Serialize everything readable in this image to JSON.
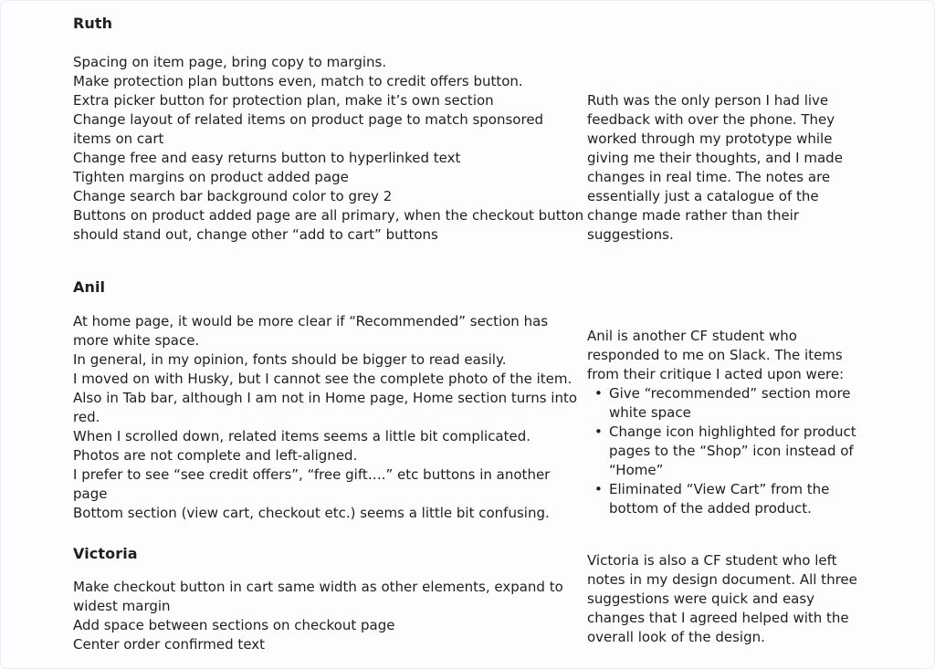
{
  "sections": [
    {
      "name": "Ruth",
      "notes": [
        "Spacing on item page, bring copy to margins.",
        "Make protection plan buttons even, match to credit offers button.",
        "Extra picker button for protection plan, make it’s own section",
        "Change layout of related items on product page to match sponsored items on cart",
        "Change free and easy returns button to hyperlinked text",
        "Tighten margins on product added page",
        "Change search bar background color to grey 2",
        "Buttons on product added page are all primary, when the checkout button should stand out, change other “add to cart” buttons"
      ],
      "summary": "Ruth was the only person I had live feedback with over the phone. They worked through my prototype while giving me their thoughts, and I made changes in real time. The notes are essentially just a catalogue of the change made rather than their suggestions."
    },
    {
      "name": "Anil",
      "notes": [
        "At home page, it would be more clear if “Recommended” section has more white space.",
        "In general, in my opinion, fonts should be bigger to read easily.",
        "I moved on with Husky, but I cannot see the complete photo of the item.",
        "Also in Tab bar, although I am not in Home page, Home section turns into red.",
        "When I scrolled down, related items seems a little bit complicated.",
        "Photos are not complete and left-aligned.",
        "I prefer to see “see credit offers”, “free gift….” etc buttons in another page",
        "Bottom section (view cart, checkout etc.) seems a little bit confusing."
      ],
      "summary": "Anil is another CF student who responded to me on Slack. The items from their critique I acted upon were:",
      "summary_bullets": [
        "Give “recommended” section more white space",
        "Change icon highlighted for product pages to the “Shop” icon instead of “Home”",
        "Eliminated “View Cart” from the bottom of the added product."
      ]
    },
    {
      "name": "Victoria",
      "notes": [
        "Make checkout button in cart same width as other elements, expand to widest margin",
        "Add space between sections on checkout page",
        "Center order confirmed text"
      ],
      "summary": "Victoria is also a CF student who left notes in my design document. All three suggestions were quick and easy changes that I agreed helped with the overall look of the design."
    }
  ]
}
